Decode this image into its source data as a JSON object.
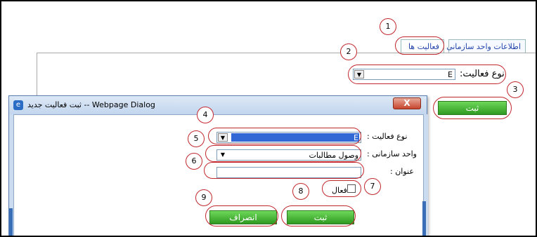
{
  "page": {
    "tabs": [
      {
        "label": "اطلاعات واحد سازمانی"
      },
      {
        "label": "فعالیت ها"
      }
    ],
    "activity_type_label": "نوع فعالیت:",
    "activity_type_value": "E",
    "submit_label": "ثبت"
  },
  "dialog": {
    "title": "ثبت فعالیت جدید -- Webpage Dialog",
    "close_label": "X",
    "activity_type_label": "نوع فعالیت :",
    "activity_type_value": "E",
    "org_unit_label": "واحد سازمانی :",
    "org_unit_value": "وصول مطالبات",
    "title_field_label": "عنوان :",
    "title_field_value": "",
    "active_label": "فعال",
    "submit_label": "ثبت",
    "cancel_label": "انصراف"
  },
  "annotations": [
    "1",
    "2",
    "3",
    "4",
    "5",
    "6",
    "7",
    "8",
    "9"
  ],
  "colors": {
    "annotation": "#c1272d",
    "button_green": "#3aa52a",
    "selection_blue": "#3168d5"
  }
}
